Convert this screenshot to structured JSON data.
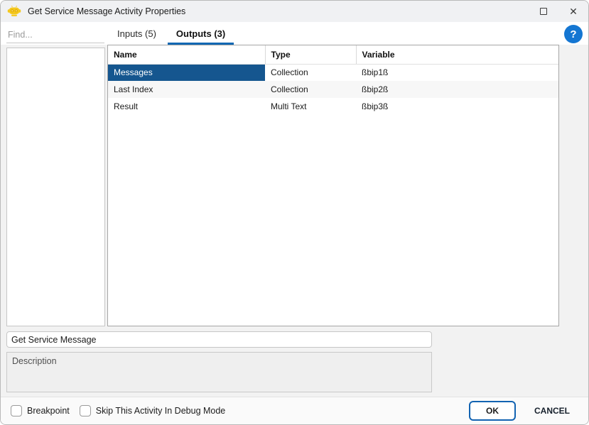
{
  "window": {
    "title": "Get Service Message Activity Properties"
  },
  "icons": {
    "app": "robot-icon",
    "maximize": "maximize",
    "close": "✕",
    "help": "?"
  },
  "search": {
    "placeholder": "Find..."
  },
  "tabs": [
    {
      "label": "Inputs (5)",
      "active": false
    },
    {
      "label": "Outputs (3)",
      "active": true
    }
  ],
  "table": {
    "columns": [
      "Name",
      "Type",
      "Variable"
    ],
    "rows": [
      {
        "name": "Messages",
        "type": "Collection",
        "variable": "ßbip1ß",
        "selected": true
      },
      {
        "name": "Last Index",
        "type": "Collection",
        "variable": "ßbip2ß",
        "selected": false
      },
      {
        "name": "Result",
        "type": "Multi Text",
        "variable": "ßbip3ß",
        "selected": false
      }
    ]
  },
  "fields": {
    "activity_name": "Get Service Message",
    "description_placeholder": "Description"
  },
  "footer": {
    "checkboxes": [
      {
        "label": "Breakpoint",
        "checked": false
      },
      {
        "label": "Skip This Activity In Debug Mode",
        "checked": false
      }
    ],
    "ok_label": "OK",
    "cancel_label": "CANCEL"
  },
  "colors": {
    "accent_blue": "#1268b3",
    "selection_blue": "#15568f",
    "help_blue": "#1476d2",
    "titlebar_bg": "#f0f1f3",
    "content_bg": "#f2f2f2"
  }
}
